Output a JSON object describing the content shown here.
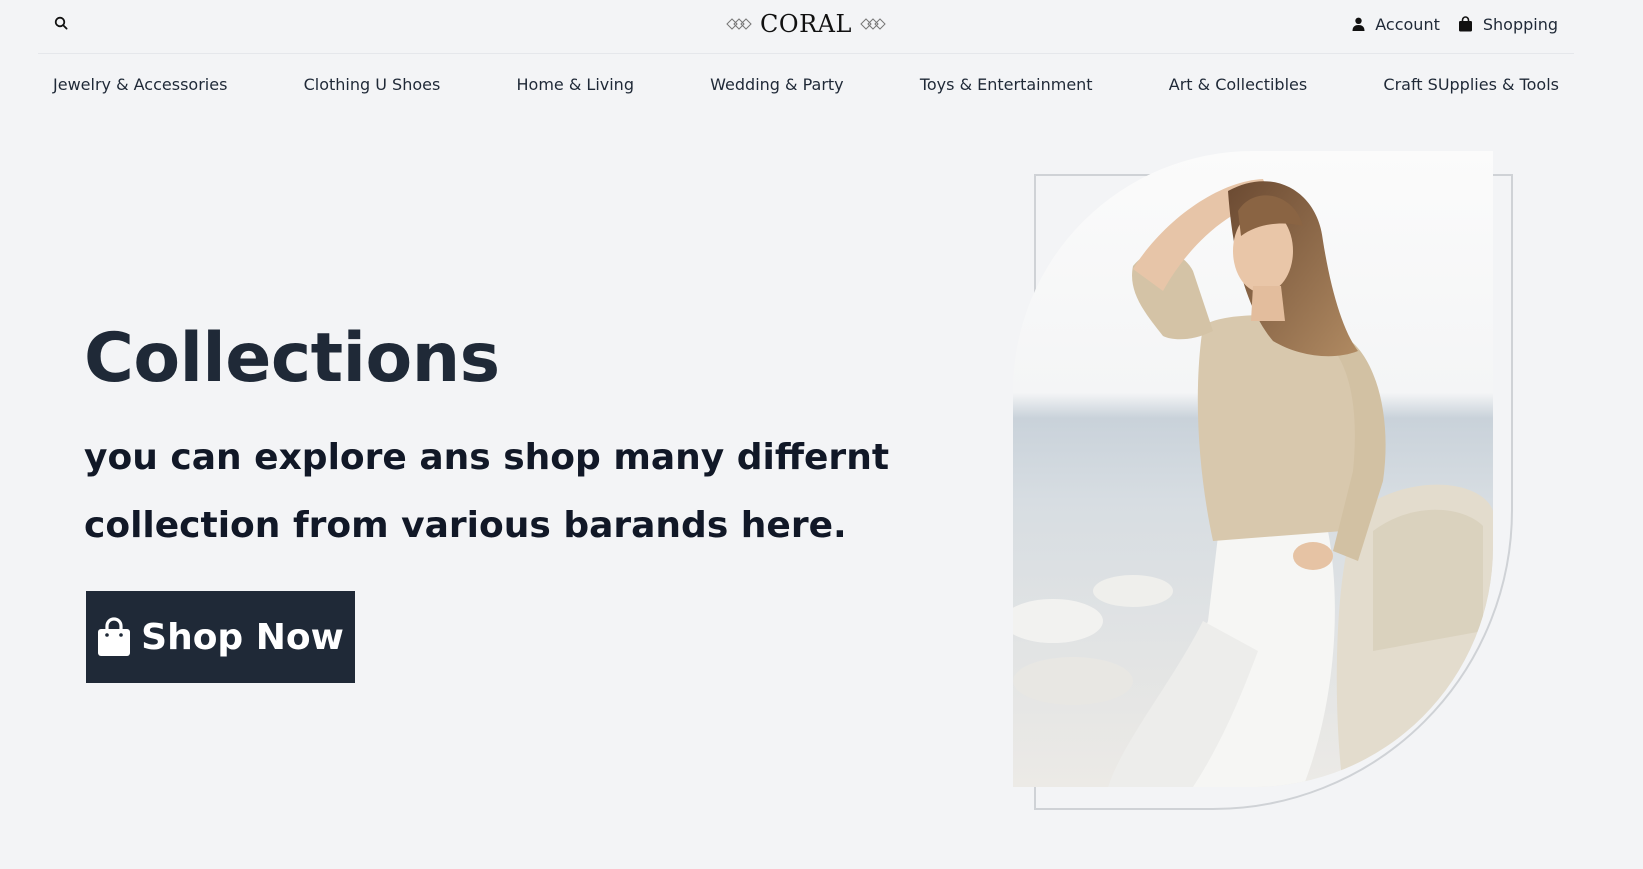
{
  "header": {
    "logo": "CORAL",
    "account_label": "Account",
    "shopping_label": "Shopping"
  },
  "categories": [
    "Jewelry & Accessories",
    "Clothing U Shoes",
    "Home & Living",
    "Wedding & Party",
    "Toys & Entertainment",
    "Art & Collectibles",
    "Craft SUpplies & Tools"
  ],
  "hero": {
    "title": "Collections",
    "subtitle": "you can explore ans shop many differnt collection from various barands here.",
    "cta_label": "Shop Now"
  },
  "icons": [
    "search-icon",
    "logo-ornament-icon",
    "user-icon",
    "shopping-bag-icon"
  ],
  "colors": {
    "background": "#f3f4f6",
    "dark": "#1f2937",
    "text": "#111827"
  }
}
